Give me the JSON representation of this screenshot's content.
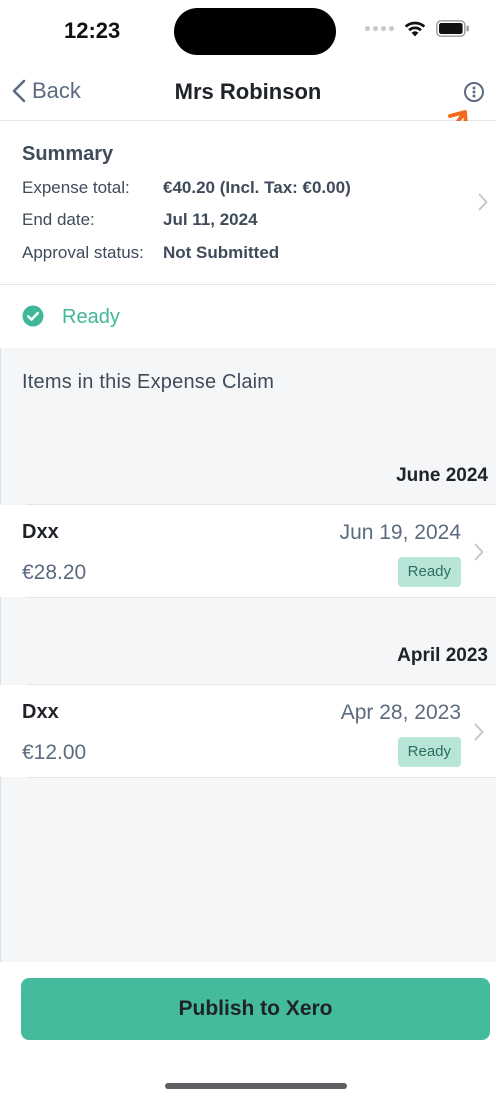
{
  "status_bar": {
    "time": "12:23"
  },
  "nav": {
    "back_label": "Back",
    "title": "Mrs Robinson",
    "more_icon": "more-info-icon"
  },
  "summary": {
    "title": "Summary",
    "rows": [
      {
        "label": "Expense total:",
        "value": "€40.20 (Incl. Tax: €0.00)"
      },
      {
        "label": "End date:",
        "value": "Jul 11, 2024"
      },
      {
        "label": "Approval status:",
        "value": "Not Submitted"
      }
    ]
  },
  "status": {
    "label": "Ready",
    "color": "#3fb89a"
  },
  "items_section": {
    "heading": "Items in this Expense Claim",
    "groups": [
      {
        "header": "June 2024",
        "items": [
          {
            "name": "Dxx",
            "date": "Jun 19, 2024",
            "amount": "€28.20",
            "badge": "Ready"
          }
        ]
      },
      {
        "header": "April 2023",
        "items": [
          {
            "name": "Dxx",
            "date": "Apr 28, 2023",
            "amount": "€12.00",
            "badge": "Ready"
          }
        ]
      }
    ]
  },
  "actions": {
    "publish_label": "Publish to Xero",
    "accent_color": "#45bb9d"
  }
}
